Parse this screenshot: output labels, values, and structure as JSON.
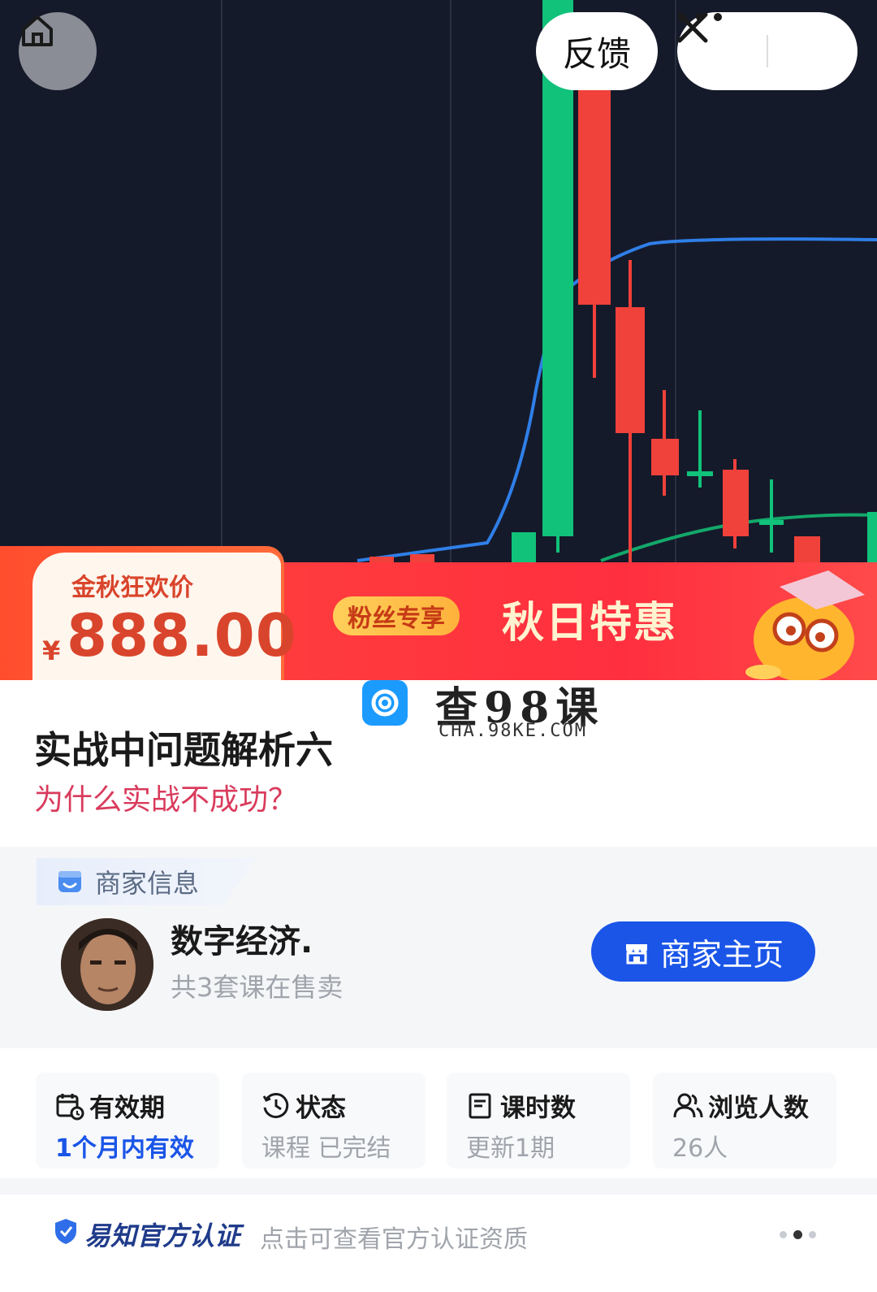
{
  "nav": {
    "feedback_label": "反馈"
  },
  "promo": {
    "price_label": "金秋狂欢价",
    "currency": "¥",
    "price": "888.00",
    "fan_tag": "粉丝专享",
    "autumn_label": "秋日特惠"
  },
  "watermark": {
    "cn": "查98课",
    "en": "CHA.98KE.COM"
  },
  "course": {
    "title": "实战中问题解析六",
    "subtitle": "为什么实战不成功？"
  },
  "merchant": {
    "section_label": "商家信息",
    "name": "数字经济.",
    "course_count": "共3套课在售卖",
    "home_button": "商家主页"
  },
  "stats": [
    {
      "label": "有效期",
      "value": "1个月内有效",
      "icon": "calendar-clock-icon"
    },
    {
      "label": "状态",
      "value": "课程 已完结",
      "icon": "clock-history-icon"
    },
    {
      "label": "课时数",
      "value": "更新1期",
      "icon": "document-icon"
    },
    {
      "label": "浏览人数",
      "value": "26人",
      "icon": "users-icon"
    }
  ],
  "certification": {
    "name": "易知官方认证",
    "description": "点击可查看官方认证资质"
  },
  "colors": {
    "accent_blue": "#1a55e8",
    "price_red": "#d9452c",
    "subtitle_pink": "#d93b5c",
    "chart_bg": "#151a2a",
    "candle_green": "#10c27a",
    "candle_red": "#f0413a"
  }
}
